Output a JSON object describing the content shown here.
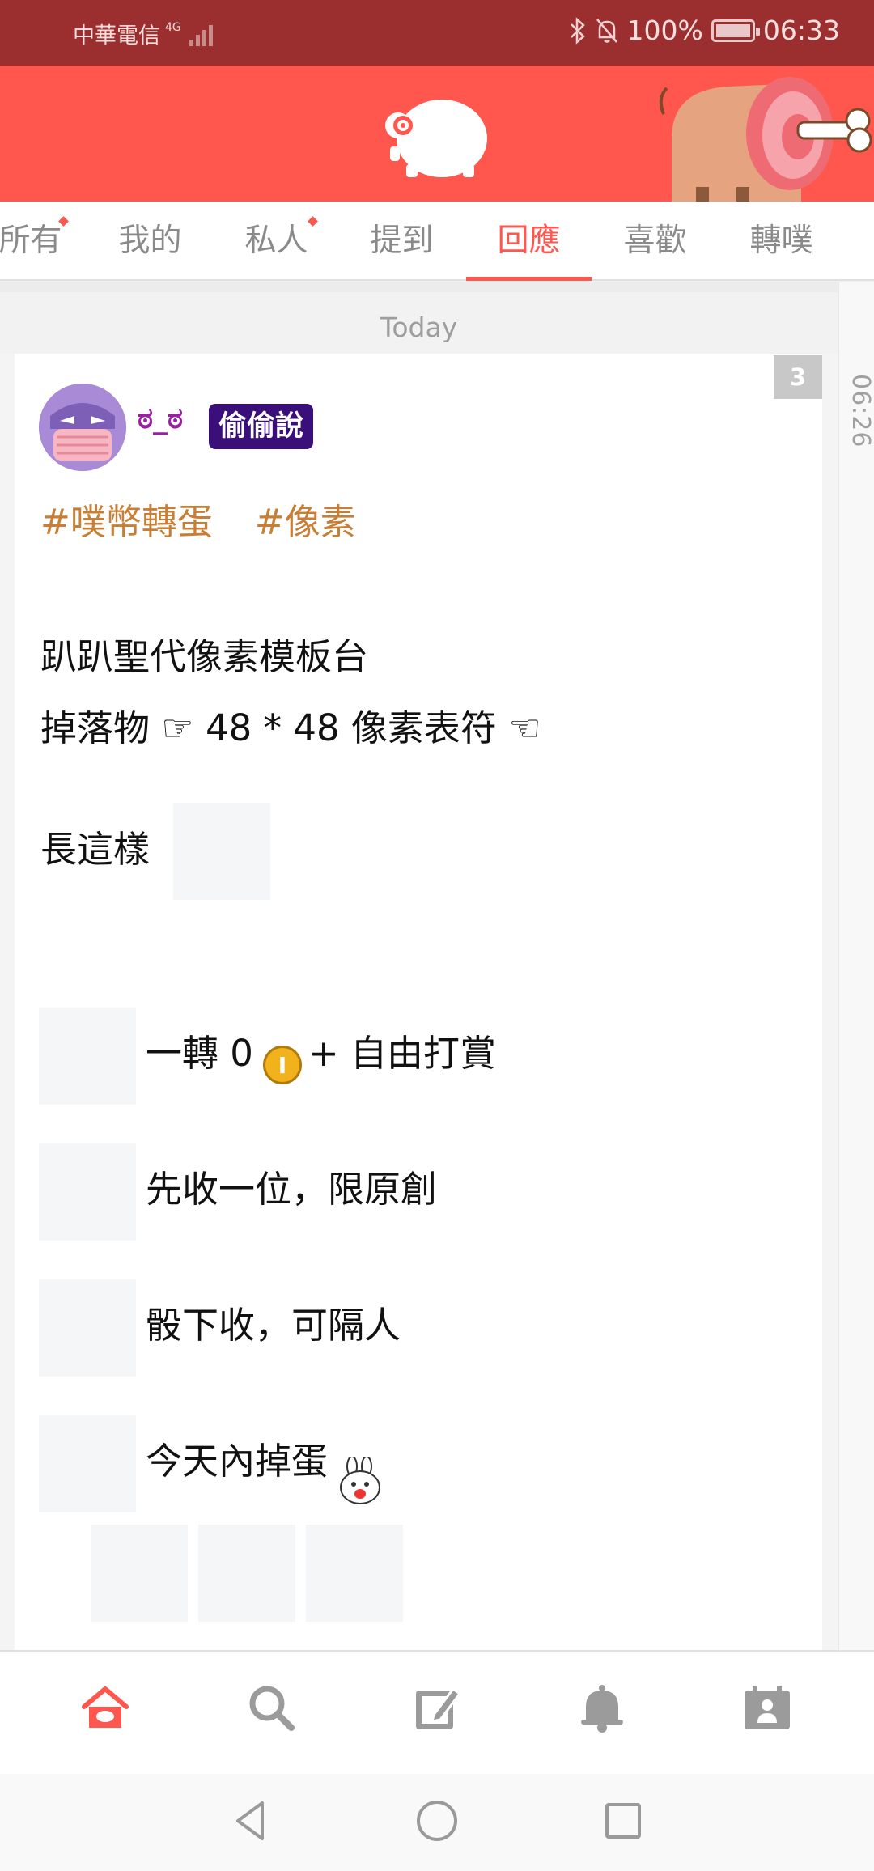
{
  "status_bar": {
    "carrier": "中華電信",
    "network": "4G",
    "battery": "100%",
    "time": "06:33",
    "icons": [
      "bluetooth-icon",
      "mute-bell-icon",
      "battery-icon"
    ]
  },
  "header": {
    "logo_icon": "plurk-logo-icon",
    "decoration_icon": "meat-bone-icon",
    "brand_color": "#ff574d"
  },
  "tabs": [
    {
      "label": "所有",
      "dot": true
    },
    {
      "label": "我的",
      "dot": false
    },
    {
      "label": "私人",
      "dot": true
    },
    {
      "label": "提到",
      "dot": false
    },
    {
      "label": "回應",
      "dot": false,
      "active": true
    },
    {
      "label": "喜歡",
      "dot": false
    },
    {
      "label": "轉噗",
      "dot": false
    }
  ],
  "timeline": {
    "day_label": "Today",
    "side_time": "06:26"
  },
  "post": {
    "response_count": "3",
    "nickname": "ಠ_ಠ",
    "qualifier": "偷偷說",
    "tags": [
      "#噗幣轉蛋",
      "#像素"
    ],
    "lines": {
      "title": "趴趴聖代像素模板台",
      "drop": "掉落物 ☞ 48 * 48 像素表符 ☜",
      "looks": "長這樣",
      "spin": "一轉 0",
      "spin_suffix": "+ 自由打賞",
      "first": "先收一位，限原創",
      "next": "骰下收，可隔人",
      "today": "今天內掉蛋"
    }
  },
  "bottom_nav": [
    "home-icon",
    "search-icon",
    "compose-icon",
    "bell-icon",
    "profile-card-icon"
  ],
  "system_nav": [
    "back-icon",
    "home-circle-icon",
    "recents-icon"
  ]
}
